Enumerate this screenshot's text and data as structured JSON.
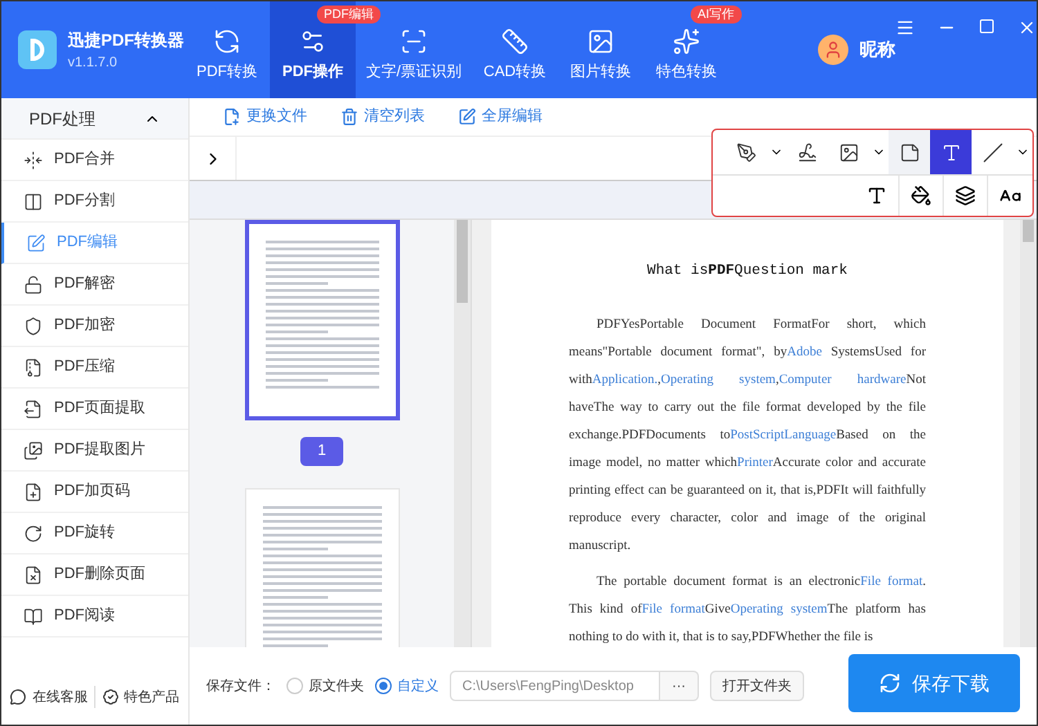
{
  "app": {
    "name": "迅捷PDF转换器",
    "version": "v1.1.7.0"
  },
  "nav_tabs": [
    {
      "label": "PDF转换",
      "selected": false
    },
    {
      "label": "PDF操作",
      "selected": true,
      "badge": "PDF编辑"
    },
    {
      "label": "文字/票证识别",
      "selected": false
    },
    {
      "label": "CAD转换",
      "selected": false
    },
    {
      "label": "图片转换",
      "selected": false
    },
    {
      "label": "特色转换",
      "selected": false,
      "badge": "AI写作"
    }
  ],
  "user": {
    "name": "昵称"
  },
  "sidebar": {
    "title": "PDF处理",
    "expanded": true,
    "items": [
      {
        "label": "PDF合并",
        "selected": false
      },
      {
        "label": "PDF分割",
        "selected": false
      },
      {
        "label": "PDF编辑",
        "selected": true
      },
      {
        "label": "PDF解密",
        "selected": false
      },
      {
        "label": "PDF加密",
        "selected": false
      },
      {
        "label": "PDF压缩",
        "selected": false
      },
      {
        "label": "PDF页面提取",
        "selected": false
      },
      {
        "label": "PDF提取图片",
        "selected": false
      },
      {
        "label": "PDF加页码",
        "selected": false
      },
      {
        "label": "PDF旋转",
        "selected": false
      },
      {
        "label": "PDF删除页面",
        "selected": false
      },
      {
        "label": "PDF阅读",
        "selected": false
      }
    ],
    "footer": [
      "在线客服",
      "特色产品"
    ]
  },
  "file_actions": [
    "更换文件",
    "清空列表",
    "全屏编辑"
  ],
  "edit_tools": [
    {
      "selected": false
    },
    {
      "selected": false
    },
    {
      "selected": false
    },
    {
      "selected": false
    },
    {
      "selected": true
    },
    {
      "selected": false
    }
  ],
  "thumbnails": [
    {
      "label": "1",
      "selected": true
    },
    {
      "selected": false
    }
  ],
  "document": {
    "title": "What is**PDF**Question mark",
    "paragraphs": [
      [
        {
          "text": "PDFYesPortable Document FormatFor short, which means\"Portable document format\", by",
          "link": false
        },
        {
          "text": "Adobe",
          "link": true
        },
        {
          "text": " SystemsUsed for with",
          "link": false
        },
        {
          "text": "Application.",
          "link": true
        },
        {
          "text": ",",
          "link": false
        },
        {
          "text": "Operating system",
          "link": true
        },
        {
          "text": ",",
          "link": false
        },
        {
          "text": "Computer hardware",
          "link": true
        },
        {
          "text": "Not haveThe way to carry out the file format developed by the file exchange.PDFDocuments to",
          "link": false
        },
        {
          "text": "PostScriptLanguage",
          "link": true
        },
        {
          "text": "Based on the image model, no matter which",
          "link": false
        },
        {
          "text": "Printer",
          "link": true
        },
        {
          "text": "Accurate color and accurate printing effect can be guaranteed on it, that is,PDFIt will faithfully reproduce every character, color and image of the original manuscript.",
          "link": false
        }
      ],
      [
        {
          "text": "The portable document format is an electronic",
          "link": false
        },
        {
          "text": "File format",
          "link": true
        },
        {
          "text": ". This kind of",
          "link": false
        },
        {
          "text": "File format",
          "link": true
        },
        {
          "text": "Give",
          "link": false
        },
        {
          "text": "Operating system",
          "link": true
        },
        {
          "text": "The platform has nothing to do with it, that is to say,PDFWhether the file is",
          "link": false
        }
      ]
    ]
  },
  "save": {
    "label": "保存文件：",
    "options": [
      {
        "label": "原文件夹",
        "selected": false
      },
      {
        "label": "自定义",
        "selected": true
      }
    ],
    "path": "C:\\Users\\FengPing\\Desktop",
    "browse": "···",
    "open_folder": "打开文件夹",
    "download": "保存下载"
  }
}
